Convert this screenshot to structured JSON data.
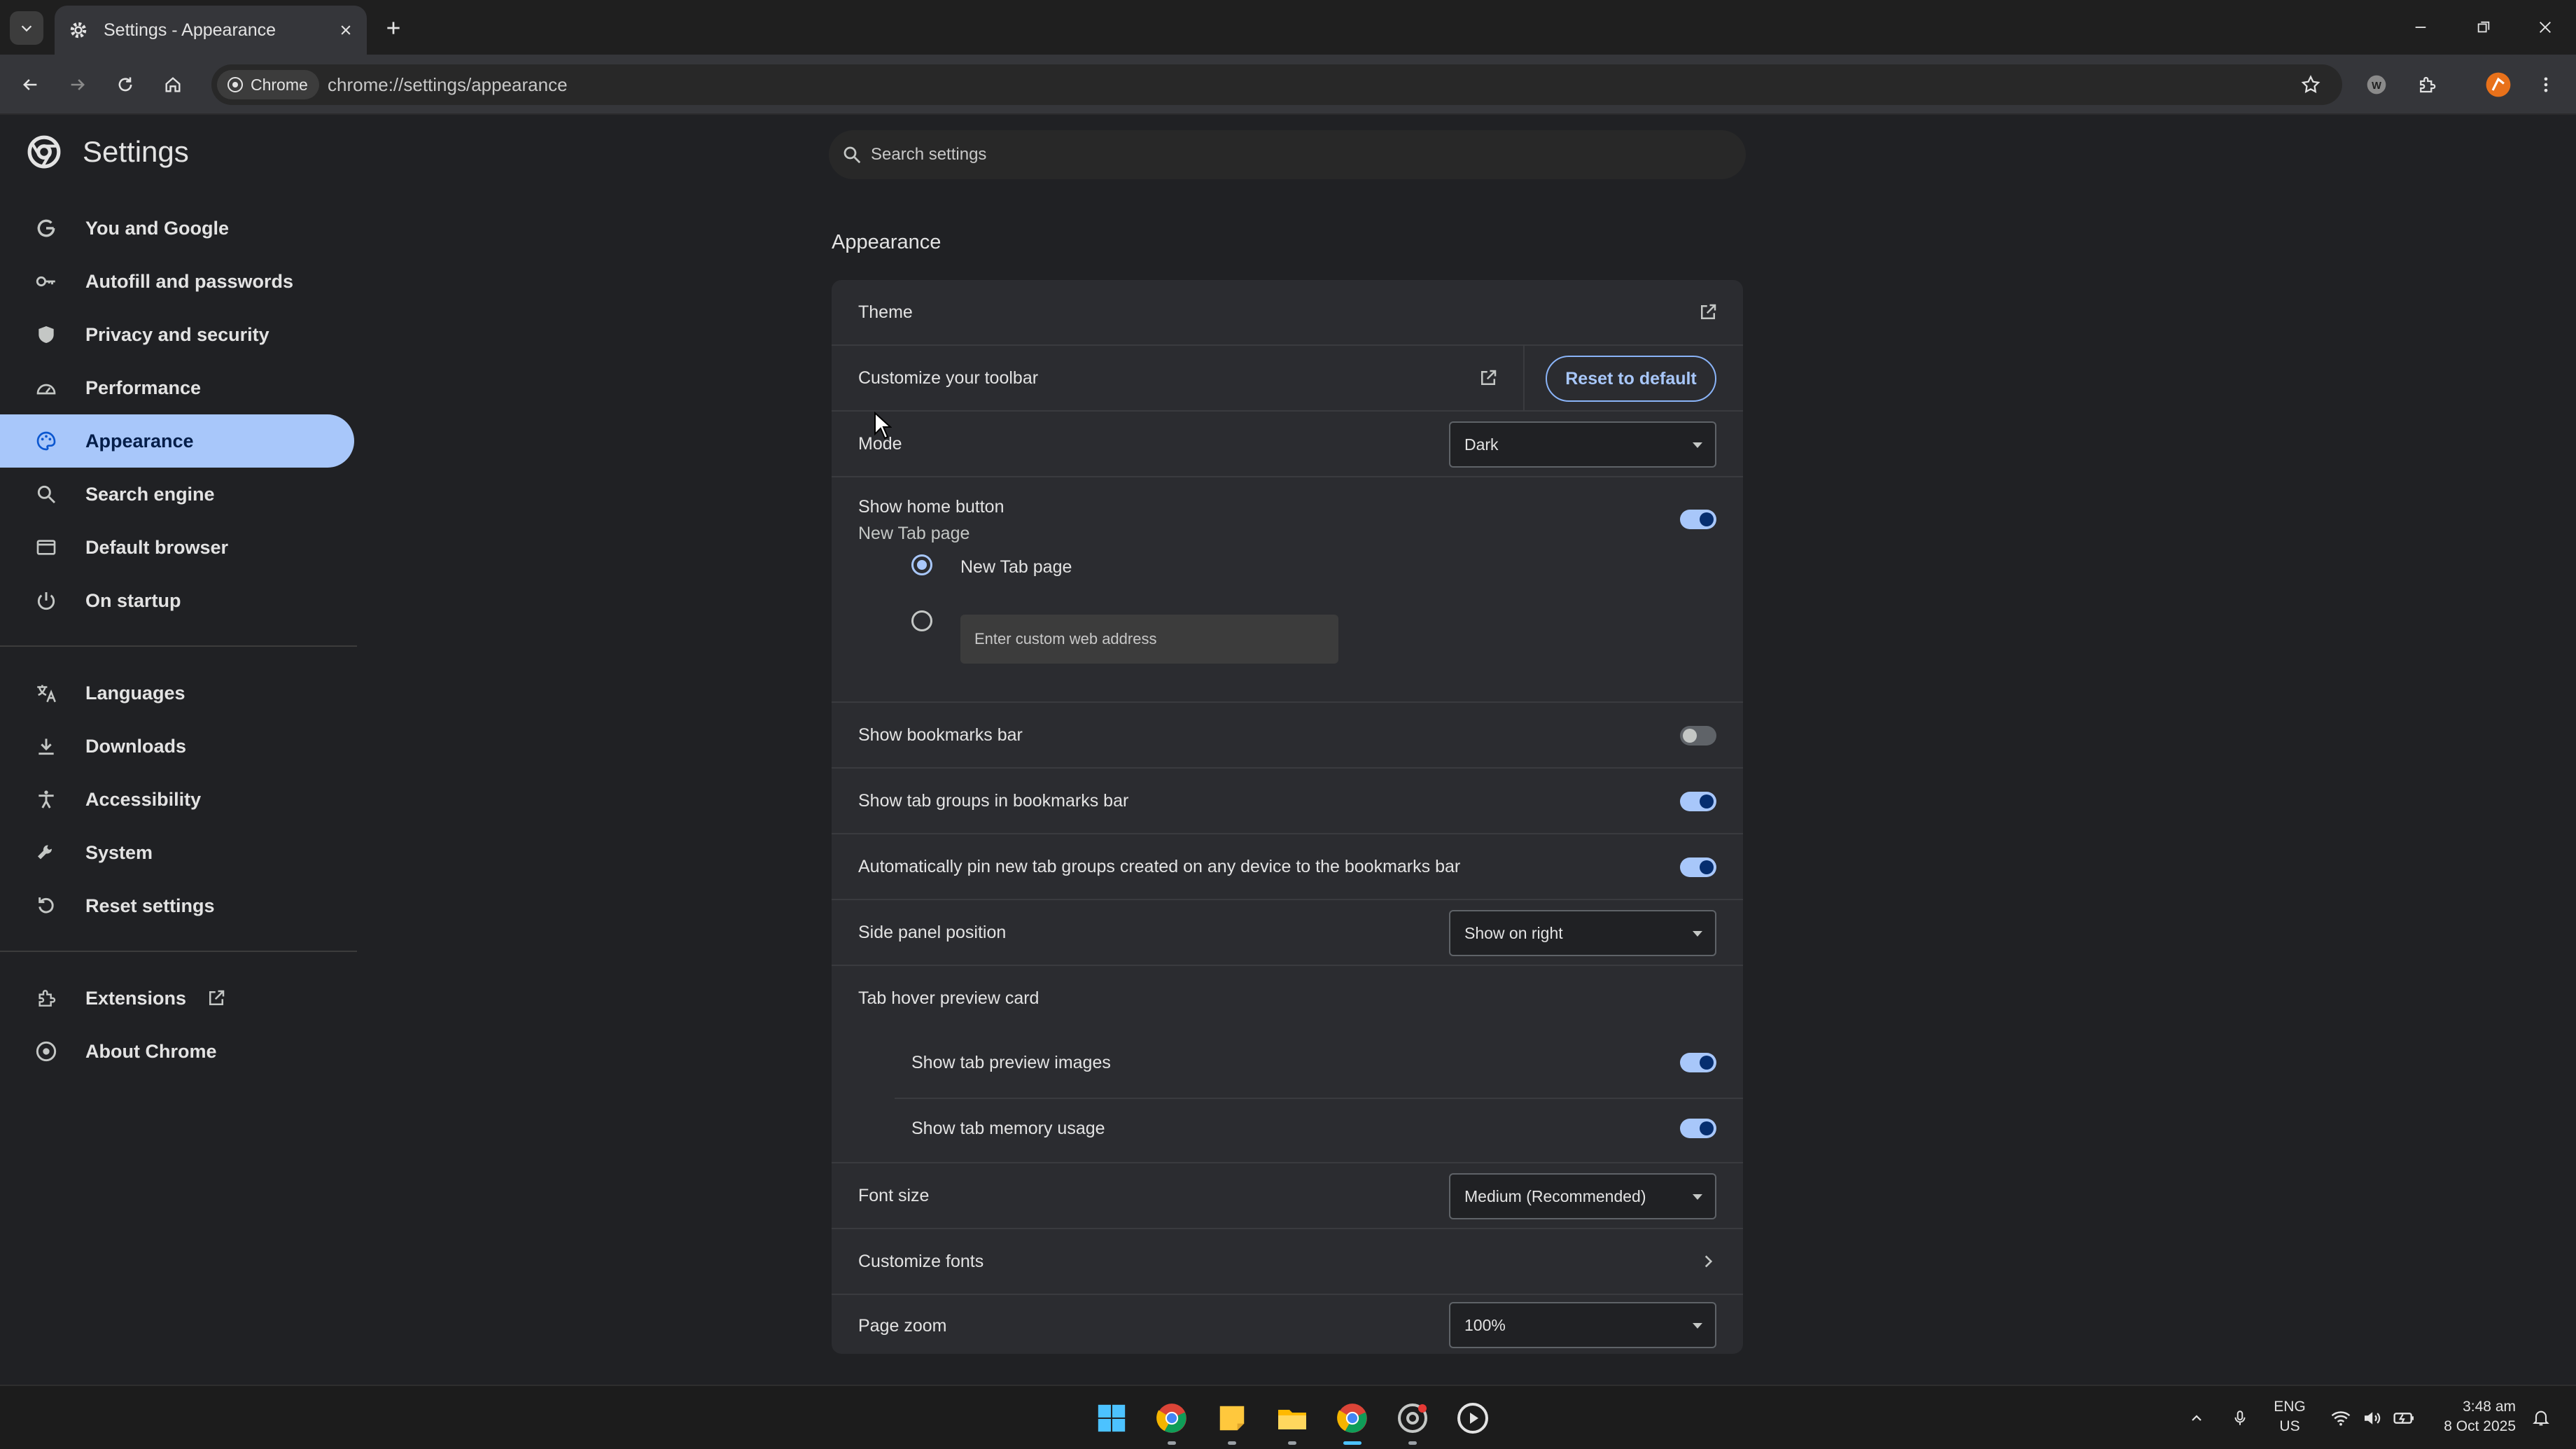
{
  "browser": {
    "tab_title": "Settings - Appearance",
    "chip_label": "Chrome",
    "url": "chrome://settings/appearance"
  },
  "sidebar": {
    "title": "Settings",
    "items": [
      {
        "label": "You and Google",
        "icon": "google-g-icon"
      },
      {
        "label": "Autofill and passwords",
        "icon": "key-icon"
      },
      {
        "label": "Privacy and security",
        "icon": "shield-icon"
      },
      {
        "label": "Performance",
        "icon": "speedometer-icon"
      },
      {
        "label": "Appearance",
        "icon": "palette-icon"
      },
      {
        "label": "Search engine",
        "icon": "search-icon"
      },
      {
        "label": "Default browser",
        "icon": "browser-window-icon"
      },
      {
        "label": "On startup",
        "icon": "power-icon"
      },
      {
        "label": "Languages",
        "icon": "translate-icon"
      },
      {
        "label": "Downloads",
        "icon": "download-icon"
      },
      {
        "label": "Accessibility",
        "icon": "accessibility-icon"
      },
      {
        "label": "System",
        "icon": "wrench-icon"
      },
      {
        "label": "Reset settings",
        "icon": "reset-icon"
      },
      {
        "label": "Extensions",
        "icon": "puzzle-icon"
      },
      {
        "label": "About Chrome",
        "icon": "chrome-logo-icon"
      }
    ],
    "active": "Appearance"
  },
  "search": {
    "placeholder": "Search settings"
  },
  "appearance": {
    "section_title": "Appearance",
    "theme_label": "Theme",
    "toolbar_label": "Customize your toolbar",
    "reset_button": "Reset to default",
    "mode_label": "Mode",
    "mode_value": "Dark",
    "home_button_label": "Show home button",
    "home_button_sublabel": "New Tab page",
    "home_button_on": true,
    "radio_new_tab": "New Tab page",
    "custom_address_placeholder": "Enter custom web address",
    "bookmarks_bar_label": "Show bookmarks bar",
    "bookmarks_bar_on": false,
    "tab_groups_label": "Show tab groups in bookmarks bar",
    "tab_groups_on": true,
    "auto_pin_label": "Automatically pin new tab groups created on any device to the bookmarks bar",
    "auto_pin_on": true,
    "side_panel_label": "Side panel position",
    "side_panel_value": "Show on right",
    "hover_card_label": "Tab hover preview card",
    "preview_images_label": "Show tab preview images",
    "preview_images_on": true,
    "memory_usage_label": "Show tab memory usage",
    "memory_usage_on": true,
    "font_size_label": "Font size",
    "font_size_value": "Medium (Recommended)",
    "customize_fonts_label": "Customize fonts",
    "page_zoom_label": "Page zoom",
    "page_zoom_value": "100%"
  },
  "taskbar": {
    "lang_top": "ENG",
    "lang_bottom": "US",
    "time": "3:48 am",
    "date": "8 Oct 2025"
  },
  "colors": {
    "accent": "#a8c7fa",
    "background": "#202124",
    "card": "#2b2c30"
  }
}
